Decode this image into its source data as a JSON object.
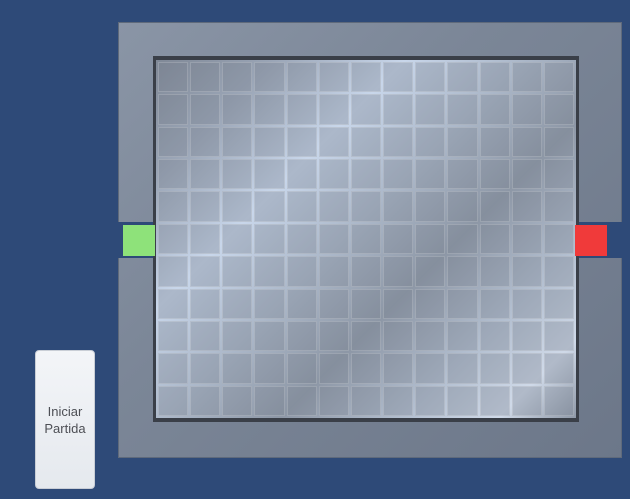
{
  "board": {
    "rows": 11,
    "cols": 13,
    "start_color": "#8ee27a",
    "end_color": "#f03a3a"
  },
  "controls": {
    "start_button_label": "Iniciar\nPartida"
  },
  "colors": {
    "background": "#2e4a78",
    "frame": "#7b8697"
  }
}
